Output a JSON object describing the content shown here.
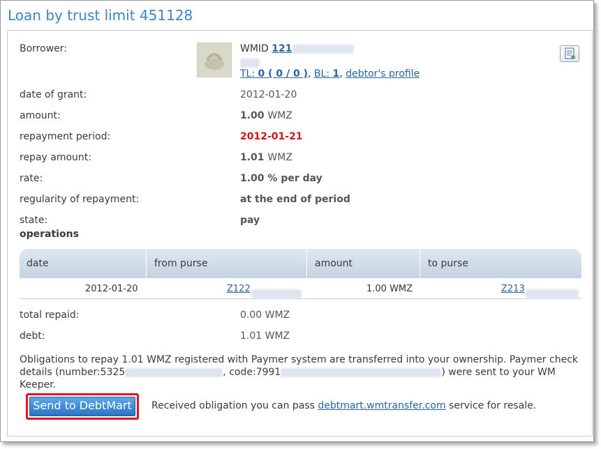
{
  "title": "Loan by trust limit 451128",
  "borrower": {
    "label": "Borrower:",
    "wmid_prefix": "WMID",
    "wmid": "121",
    "tl_label": "TL:",
    "tl_value": "0 ( 0 / 0 )",
    "bl_label": "BL:",
    "bl_value": "1",
    "profile_link": "debtor's profile",
    "icons": {
      "avatar": "avatar-image",
      "note": "note-icon"
    }
  },
  "fields": {
    "date_of_grant": {
      "label": "date of grant:",
      "value": "2012-01-20"
    },
    "amount": {
      "label": "amount:",
      "value": "1.00",
      "unit": "WMZ"
    },
    "repayment_period": {
      "label": "repayment period:",
      "value": "2012-01-21"
    },
    "repay_amount": {
      "label": "repay amount:",
      "value": "1.01",
      "unit": "WMZ"
    },
    "rate": {
      "label": "rate:",
      "value": "1.00 % per day"
    },
    "regularity": {
      "label": "regularity of repayment:",
      "value": "at the end of period"
    },
    "state": {
      "label": "state:",
      "value": "pay"
    }
  },
  "operations": {
    "heading": "operations",
    "columns": [
      "date",
      "from purse",
      "amount",
      "to purse"
    ],
    "rows": [
      {
        "date": "2012-01-20",
        "from_purse": "Z122",
        "amount": "1.00 WMZ",
        "to_purse": "Z213"
      }
    ]
  },
  "totals": {
    "total_repaid": {
      "label": "total repaid:",
      "value": "0.00 WMZ"
    },
    "debt": {
      "label": "debt:",
      "value": "1.01 WMZ"
    }
  },
  "message": {
    "part1": "Obligations to repay 1.01 WMZ registered with Paymer system are transferred into your ownership. Paymer check details (number:5325",
    "part2": ", code:7991",
    "part3": ") were sent to your WM Keeper."
  },
  "actions": {
    "send_button": "Send to DebtMart",
    "resale_before": "Received obligation you can pass ",
    "resale_link": "debtmart.wmtransfer.com",
    "resale_after": " service for resale."
  },
  "colors": {
    "title": "#3a86c8",
    "link": "#2863a4",
    "due_date": "#d0141c",
    "button": "#2a74c6",
    "button_highlight": "#e0141e"
  }
}
